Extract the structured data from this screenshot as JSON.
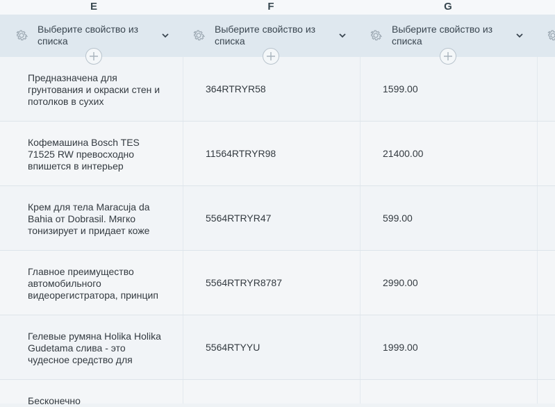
{
  "columns": [
    {
      "letter": "E",
      "header_label": "Выберите свойство из списка"
    },
    {
      "letter": "F",
      "header_label": "Выберите свойство из списка"
    },
    {
      "letter": "G",
      "header_label": "Выберите свойство из списка"
    }
  ],
  "rows": [
    {
      "description": "Предназначена для грунтования и окраски стен и потолков в сухих",
      "code": "364RTRYR58",
      "price": "1599.00"
    },
    {
      "description": "Кофемашина Bosch TES 71525 RW превосходно впишется в интерьер",
      "code": "11564RTRYR98",
      "price": "21400.00"
    },
    {
      "description": "Крем для тела Maracuja da Bahia от Dobrasil. Мягко тонизирует и придает коже",
      "code": "5564RTRYR47",
      "price": "599.00"
    },
    {
      "description": "Главное преимущество автомобильного видеорегистратора, принцип",
      "code": "5564RTRYR8787",
      "price": "2990.00"
    },
    {
      "description": "Гелевые румяна Holika Holika Gudetama слива - это чудесное средство для",
      "code": "5564RTYYU",
      "price": "1999.00"
    },
    {
      "description": "Бесконечно",
      "code": "",
      "price": ""
    }
  ],
  "icons": {
    "settings": "gear-icon",
    "dropdown": "chevron-down-icon",
    "add_column": "plus-icon"
  }
}
